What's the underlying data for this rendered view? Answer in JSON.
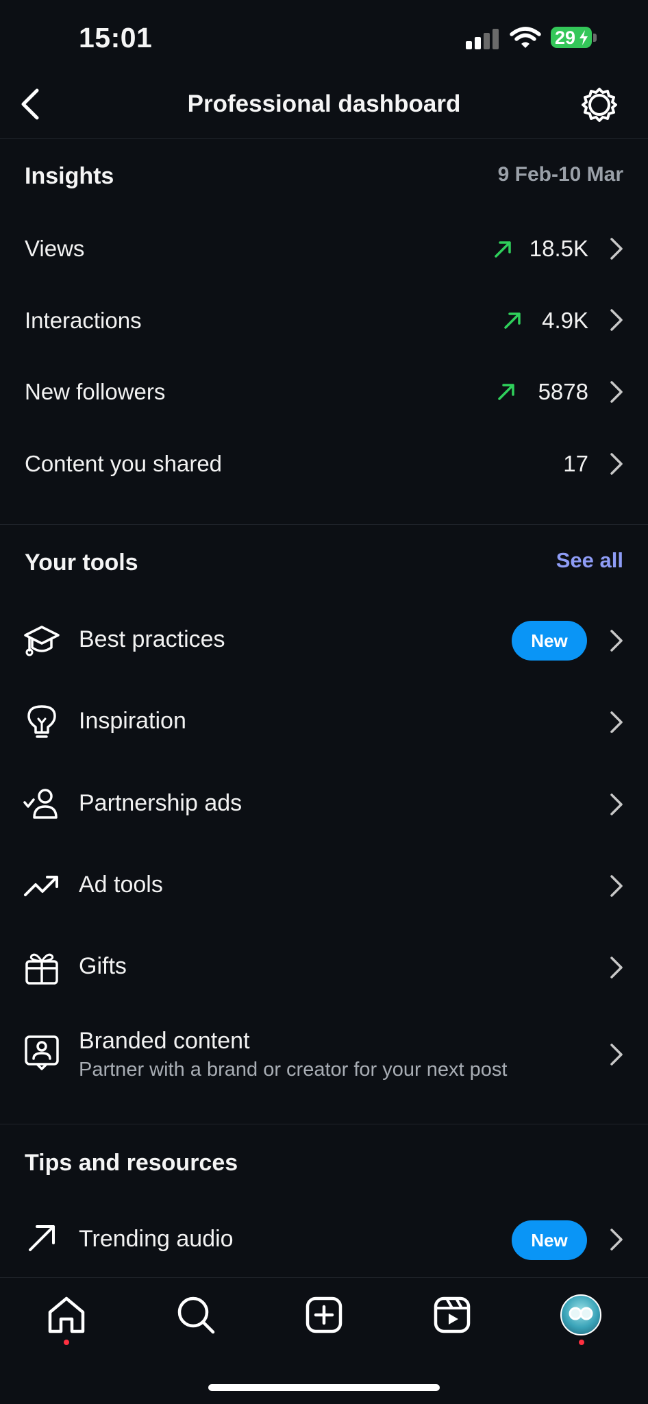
{
  "status_bar": {
    "time": "15:01",
    "battery": "29"
  },
  "header": {
    "title": "Professional dashboard",
    "back_icon": "chevron-left-icon",
    "settings_icon": "gear-icon"
  },
  "insights": {
    "title": "Insights",
    "date_range": "9 Feb-10 Mar",
    "rows": [
      {
        "label": "Views",
        "value": "18.5K",
        "trend": "up"
      },
      {
        "label": "Interactions",
        "value": "4.9K",
        "trend": "up"
      },
      {
        "label": "New followers",
        "value": "5878",
        "trend": "up"
      },
      {
        "label": "Content you shared",
        "value": "17"
      }
    ],
    "trend_color": "#2fd05b"
  },
  "tools": {
    "title": "Your tools",
    "see_all": "See all",
    "items": [
      {
        "label": "Best practices",
        "badge": "New",
        "icon": "graduation-cap-icon"
      },
      {
        "label": "Inspiration",
        "icon": "lightbulb-icon"
      },
      {
        "label": "Partnership ads",
        "icon": "person-check-icon"
      },
      {
        "label": "Ad tools",
        "icon": "trending-up-icon"
      },
      {
        "label": "Gifts",
        "icon": "gift-icon"
      },
      {
        "label": "Branded content",
        "subtitle": "Partner with a brand or creator for your next post",
        "icon": "branded-content-icon"
      }
    ]
  },
  "tips": {
    "title": "Tips and resources",
    "items": [
      {
        "label": "Trending audio",
        "badge": "New",
        "icon": "arrow-up-right-icon"
      }
    ]
  },
  "tabbar": {
    "items": [
      "home-icon",
      "search-icon",
      "create-icon",
      "reels-icon",
      "profile-avatar"
    ],
    "notification_color": "#ff3040"
  },
  "colors": {
    "background": "#0c0f14",
    "accent": "#0a95f6",
    "link": "#8e9cf5"
  }
}
